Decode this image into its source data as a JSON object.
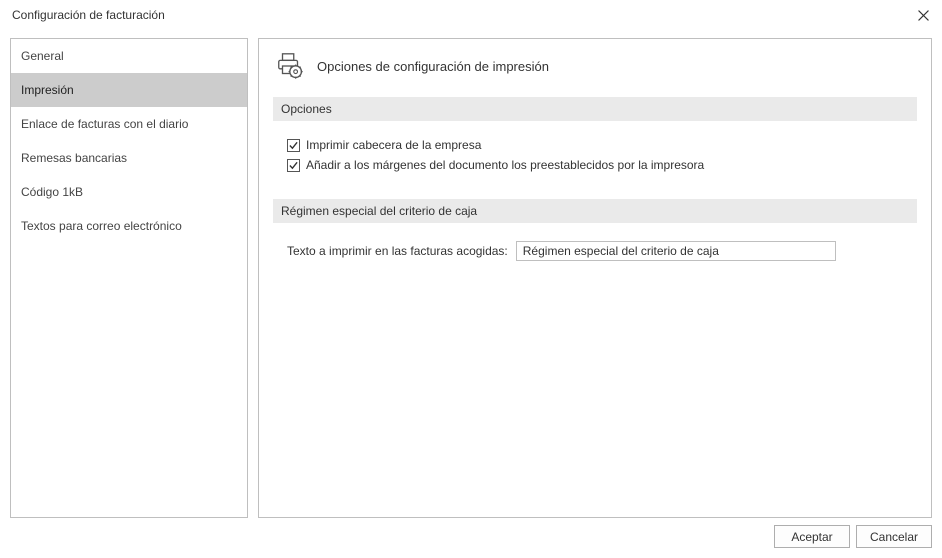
{
  "window": {
    "title": "Configuración de facturación"
  },
  "sidebar": {
    "items": [
      {
        "label": "General"
      },
      {
        "label": "Impresión"
      },
      {
        "label": "Enlace de facturas con el diario"
      },
      {
        "label": "Remesas bancarias"
      },
      {
        "label": "Código 1kB"
      },
      {
        "label": "Textos para correo electrónico"
      }
    ],
    "selected_index": 1
  },
  "main": {
    "header_title": "Opciones de configuración de impresión",
    "sections": {
      "opciones": {
        "title": "Opciones",
        "checkboxes": [
          {
            "label": "Imprimir cabecera de la empresa",
            "checked": true
          },
          {
            "label": "Añadir a los márgenes del documento los preestablecidos por la impresora",
            "checked": true
          }
        ]
      },
      "regimen": {
        "title": "Régimen especial del criterio de caja",
        "field_label": "Texto a imprimir en las facturas acogidas:",
        "field_value": "Régimen especial del criterio de caja"
      }
    }
  },
  "footer": {
    "accept": "Aceptar",
    "cancel": "Cancelar"
  }
}
